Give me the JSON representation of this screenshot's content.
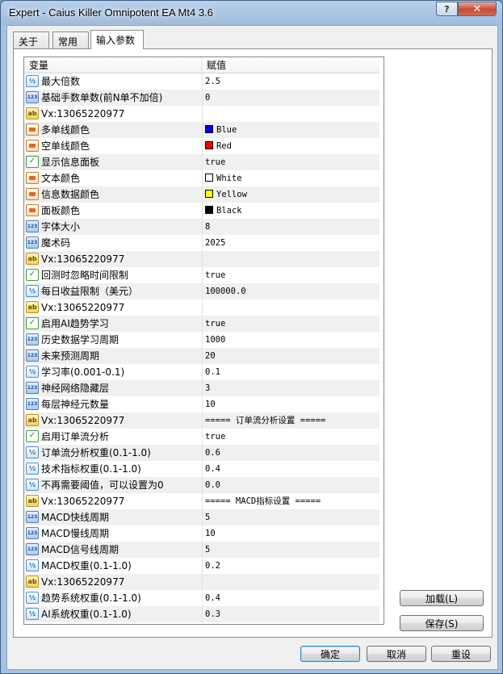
{
  "window": {
    "title": "Expert - Caius Killer Omnipotent EA Mt4 3.6",
    "help_glyph": "?",
    "close_glyph": "✕"
  },
  "tabs": [
    {
      "label": "关于"
    },
    {
      "label": "常用"
    },
    {
      "label": "输入参数"
    }
  ],
  "grid": {
    "headers": {
      "variable": "变量",
      "value": "赋值"
    },
    "rows": [
      {
        "icon": "double-icon",
        "name": "最大倍数",
        "value": "2.5"
      },
      {
        "icon": "integer-icon",
        "name": "基础手数单数(前N单不加倍)",
        "value": "0"
      },
      {
        "icon": "string-icon",
        "name": "Vx:13065220977",
        "value": ""
      },
      {
        "icon": "color-icon",
        "name": "多单线颜色",
        "value": "Blue",
        "color": "#0000ff"
      },
      {
        "icon": "color-icon",
        "name": "空单线颜色",
        "value": "Red",
        "color": "#ff0000"
      },
      {
        "icon": "bool-icon",
        "name": "显示信息面板",
        "value": "true"
      },
      {
        "icon": "color-icon",
        "name": "文本颜色",
        "value": "White",
        "color": "#ffffff"
      },
      {
        "icon": "color-icon",
        "name": "信息数据颜色",
        "value": "Yellow",
        "color": "#ffff00"
      },
      {
        "icon": "color-icon",
        "name": "面板颜色",
        "value": "Black",
        "color": "#000000"
      },
      {
        "icon": "integer-icon",
        "name": "字体大小",
        "value": "8"
      },
      {
        "icon": "integer-icon",
        "name": "魔术码",
        "value": "2025"
      },
      {
        "icon": "string-icon",
        "name": "Vx:13065220977",
        "value": ""
      },
      {
        "icon": "bool-icon",
        "name": "回测时忽略时间限制",
        "value": "true"
      },
      {
        "icon": "double-icon",
        "name": "每日收益限制（美元）",
        "value": "100000.0"
      },
      {
        "icon": "string-icon",
        "name": "Vx:13065220977",
        "value": ""
      },
      {
        "icon": "bool-icon",
        "name": "启用AI趋势学习",
        "value": "true"
      },
      {
        "icon": "integer-icon",
        "name": "历史数据学习周期",
        "value": "1000"
      },
      {
        "icon": "integer-icon",
        "name": "未来预测周期",
        "value": "20"
      },
      {
        "icon": "double-icon",
        "name": "学习率(0.001-0.1)",
        "value": "0.1"
      },
      {
        "icon": "integer-icon",
        "name": "神经网络隐藏层",
        "value": "3"
      },
      {
        "icon": "integer-icon",
        "name": "每层神经元数量",
        "value": "10"
      },
      {
        "icon": "string-icon",
        "name": "Vx:13065220977",
        "value": "===== 订单流分析设置 ====="
      },
      {
        "icon": "bool-icon",
        "name": "启用订单流分析",
        "value": "true"
      },
      {
        "icon": "double-icon",
        "name": "订单流分析权重(0.1-1.0)",
        "value": "0.6"
      },
      {
        "icon": "double-icon",
        "name": "技术指标权重(0.1-1.0)",
        "value": "0.4"
      },
      {
        "icon": "double-icon",
        "name": "不再需要阈值，可以设置为0",
        "value": "0.0"
      },
      {
        "icon": "string-icon",
        "name": "Vx:13065220977",
        "value": "===== MACD指标设置 ====="
      },
      {
        "icon": "integer-icon",
        "name": "MACD快线周期",
        "value": "5"
      },
      {
        "icon": "integer-icon",
        "name": "MACD慢线周期",
        "value": "10"
      },
      {
        "icon": "integer-icon",
        "name": "MACD信号线周期",
        "value": "5"
      },
      {
        "icon": "double-icon",
        "name": "MACD权重(0.1-1.0)",
        "value": "0.2"
      },
      {
        "icon": "string-icon",
        "name": "Vx:13065220977",
        "value": ""
      },
      {
        "icon": "double-icon",
        "name": "趋势系统权重(0.1-1.0)",
        "value": "0.4"
      },
      {
        "icon": "double-icon",
        "name": "AI系统权重(0.1-1.0)",
        "value": "0.3"
      }
    ]
  },
  "scrollbar": {
    "up_glyph": "▲",
    "down_glyph": "▼",
    "grip_glyph": "≡",
    "position": 1.0
  },
  "side_buttons": {
    "load": "加载(L)",
    "save": "保存(S)"
  },
  "footer_buttons": {
    "ok": "确定",
    "cancel": "取消",
    "reset": "重设"
  }
}
